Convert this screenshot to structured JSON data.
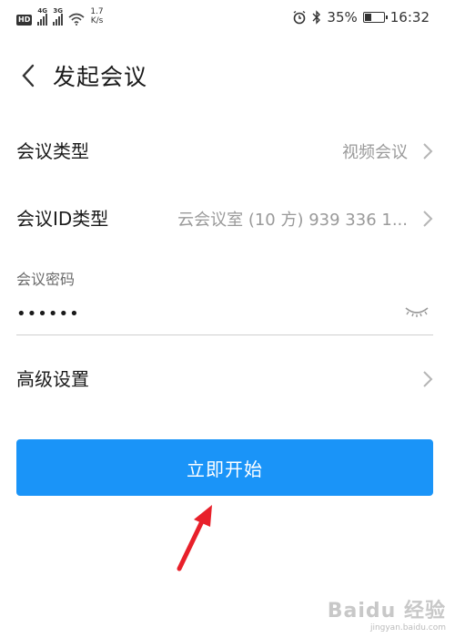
{
  "status_bar": {
    "hd": "HD",
    "sim1": "4G",
    "sim2": "3G",
    "speed_value": "1.7",
    "speed_unit": "K/s",
    "battery_percent": "35%",
    "battery_level": 0.35,
    "time": "16:32"
  },
  "header": {
    "title": "发起会议"
  },
  "rows": {
    "meeting_type": {
      "label": "会议类型",
      "value": "视频会议"
    },
    "meeting_id_type": {
      "label": "会议ID类型",
      "value": "云会议室 (10 方) 939 336 1..."
    },
    "password": {
      "label": "会议密码",
      "value": "••••••"
    },
    "advanced": {
      "label": "高级设置"
    }
  },
  "start_button": {
    "label": "立即开始"
  },
  "watermark": {
    "logo": "Baidu 经验",
    "url": "jingyan.baidu.com"
  },
  "colors": {
    "primary": "#1a94f8",
    "annotation": "#e8202a"
  }
}
